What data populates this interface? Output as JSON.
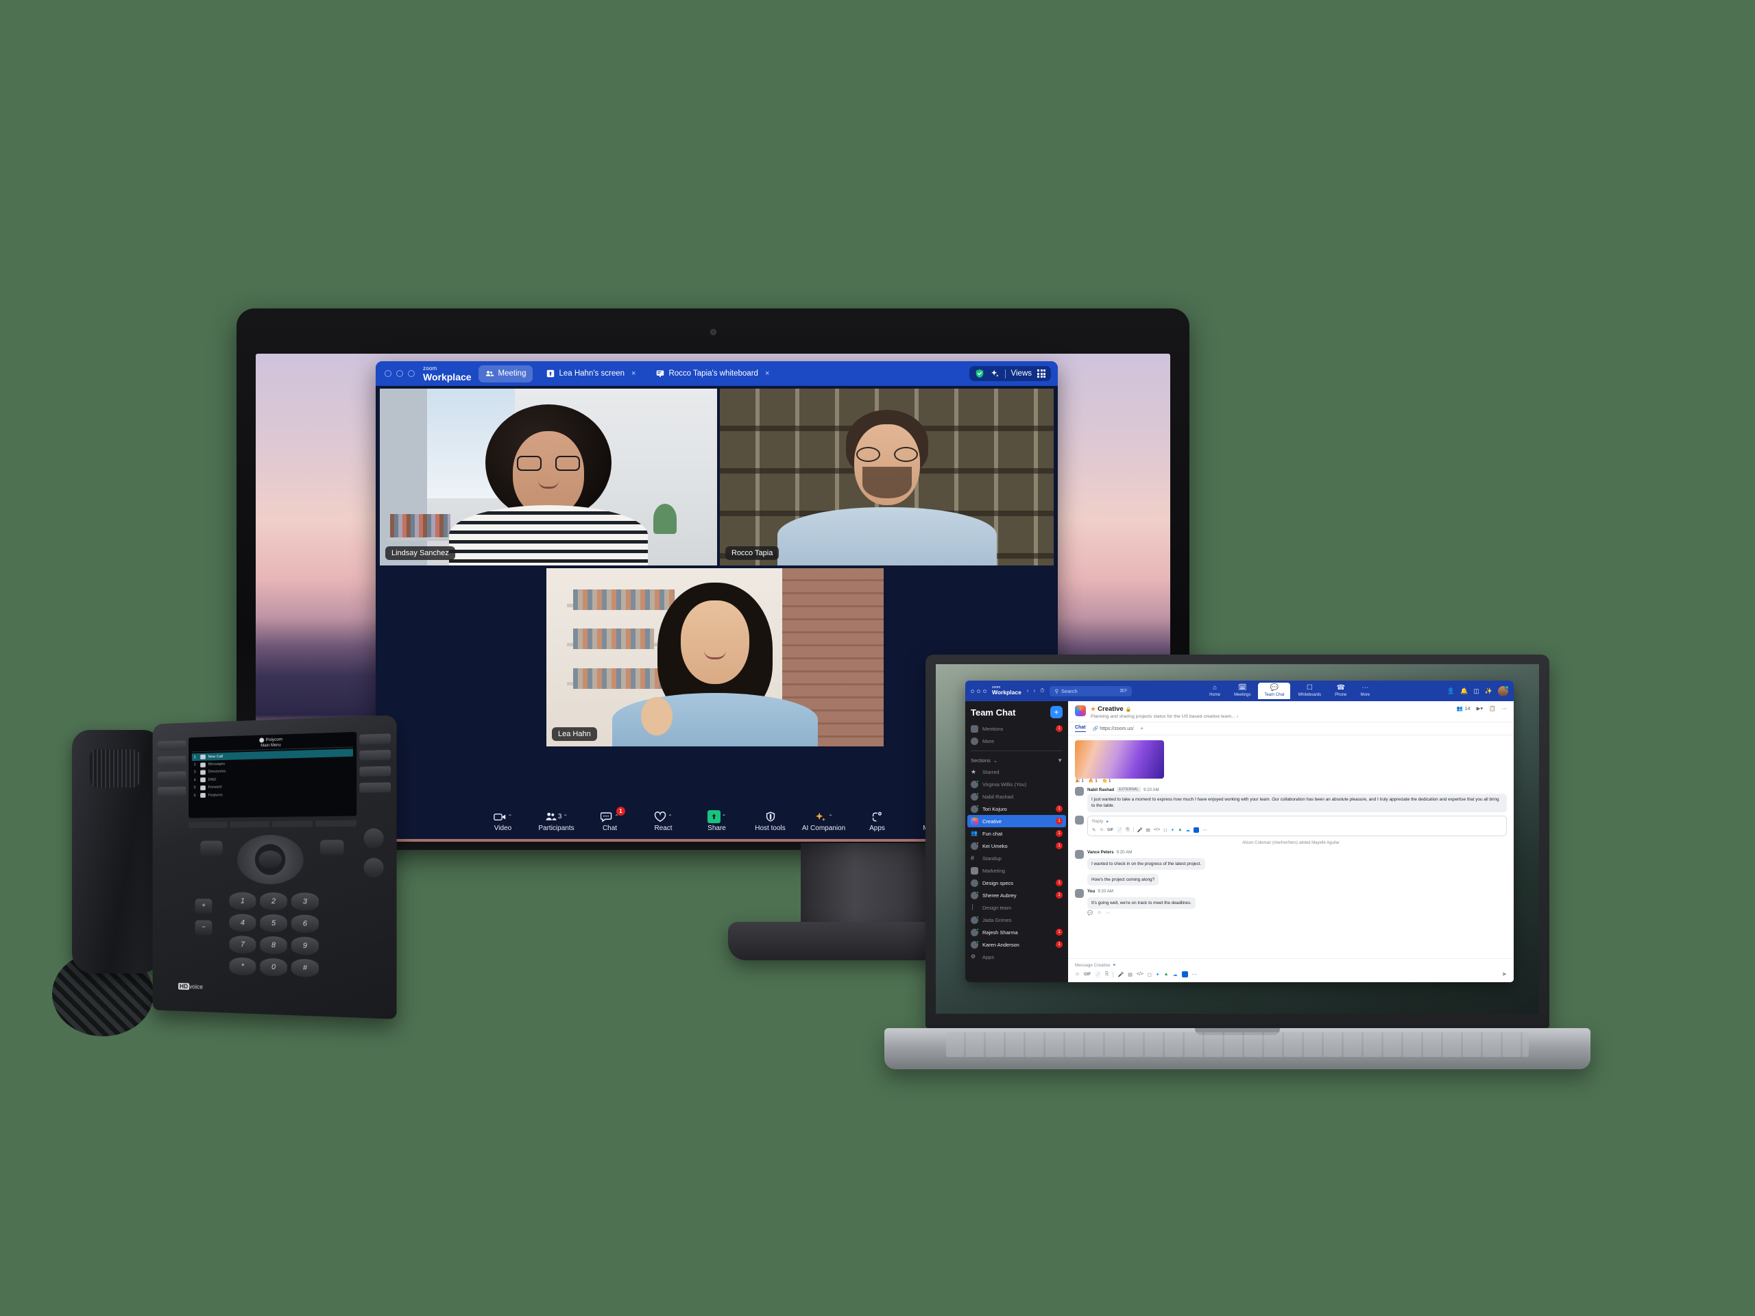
{
  "scene": {
    "background_color": "#4e7152",
    "devices": [
      "desktop-monitor",
      "laptop",
      "desk-phone"
    ]
  },
  "meeting_window": {
    "brand_line1": "zoom",
    "brand_line2": "Workplace",
    "tabs": [
      {
        "label": "Meeting",
        "icon": "participants-icon",
        "active": true,
        "closable": false
      },
      {
        "label": "Lea Hahn's screen",
        "icon": "share-screen-icon",
        "active": false,
        "closable": true,
        "close": "×"
      },
      {
        "label": "Rocco Tapia's whiteboard",
        "icon": "whiteboard-icon",
        "active": false,
        "closable": true,
        "close": "×"
      }
    ],
    "right_controls": {
      "encryption_icon": "shield-check-icon",
      "ai_icon": "ai-companion-sparkle-icon",
      "views_label": "Views",
      "views_icon": "grid-icon"
    },
    "participants": [
      {
        "name": "Lindsay Sanchez",
        "position": "top-left"
      },
      {
        "name": "Rocco Tapia",
        "position": "top-right"
      },
      {
        "name": "Lea Hahn",
        "position": "bottom-center"
      }
    ],
    "toolbar": [
      {
        "label": "Video",
        "icon": "video-camera-icon",
        "caret": "⌃",
        "badge": ""
      },
      {
        "label": "Participants",
        "icon": "participants-icon",
        "count": "3",
        "caret": "⌃",
        "badge": ""
      },
      {
        "label": "Chat",
        "icon": "chat-bubble-icon",
        "caret": "⌃",
        "badge": "1"
      },
      {
        "label": "React",
        "icon": "heart-icon",
        "caret": "⌃",
        "badge": ""
      },
      {
        "label": "Share",
        "icon": "share-arrow-icon",
        "caret": "⌃",
        "badge": ""
      },
      {
        "label": "Host tools",
        "icon": "shield-icon",
        "caret": "",
        "badge": ""
      },
      {
        "label": "AI Companion",
        "icon": "sparkle-icon",
        "caret": "⌃",
        "badge": ""
      },
      {
        "label": "Apps",
        "icon": "apps-icon",
        "caret": "",
        "badge": ""
      },
      {
        "label": "More",
        "icon": "more-dots-icon",
        "caret": "",
        "badge": "dot"
      }
    ]
  },
  "workplace": {
    "brand_line1": "zoom",
    "brand_line2": "Workplace",
    "nav_back": "‹",
    "nav_forward": "›",
    "history_icon": "clock-icon",
    "search": {
      "placeholder": "Search",
      "icon": "search-icon",
      "shortcut": "⌘F"
    },
    "main_menu": [
      {
        "label": "Home",
        "icon": "home-icon",
        "active": false
      },
      {
        "label": "Meetings",
        "icon": "calendar-icon",
        "active": false
      },
      {
        "label": "Team Chat",
        "icon": "team-chat-icon",
        "active": true
      },
      {
        "label": "Whiteboards",
        "icon": "whiteboard-icon",
        "active": false
      },
      {
        "label": "Phone",
        "icon": "phone-icon",
        "active": false
      },
      {
        "label": "More",
        "icon": "more-dots-icon",
        "active": false
      }
    ],
    "top_right_icons": [
      "contacts-icon",
      "bell-icon",
      "panel-icon",
      "sparkle-icon",
      "avatar"
    ],
    "sidebar": {
      "title": "Team Chat",
      "add_button": "+",
      "top_items": [
        {
          "label": "Mentions",
          "icon": "at-icon",
          "count": "1",
          "avatar": false
        },
        {
          "label": "More",
          "icon": "avatar-icon",
          "count": "",
          "avatar": true
        }
      ],
      "sections_label": "Sections",
      "sections_caret": "⌄",
      "filter_icon": "filter-icon",
      "items": [
        {
          "label": "Starred",
          "icon": "star-icon",
          "count": "",
          "type": "group",
          "presence": ""
        },
        {
          "label": "Virginia Willis (You)",
          "icon": "avatar",
          "count": "",
          "type": "dm",
          "presence": "available"
        },
        {
          "label": "Nabil Rashad",
          "icon": "avatar",
          "count": "",
          "type": "dm",
          "presence": "available"
        },
        {
          "label": "Tori Kojuro",
          "icon": "avatar",
          "count": "1",
          "type": "dm",
          "presence": "available"
        },
        {
          "label": "Creative",
          "icon": "channel-avatar",
          "count": "1",
          "type": "channel",
          "selected": true,
          "presence": ""
        },
        {
          "label": "Fun chat",
          "icon": "group-icon",
          "count": "1",
          "type": "channel",
          "presence": ""
        },
        {
          "label": "Kei Umeko",
          "icon": "avatar",
          "count": "1",
          "type": "dm",
          "presence": "away"
        },
        {
          "label": "Standup",
          "icon": "hash-icon",
          "count": "",
          "type": "channel",
          "presence": ""
        },
        {
          "label": "Marketing",
          "icon": "folder-icon",
          "count": "",
          "type": "folder",
          "presence": ""
        },
        {
          "label": "Design specs",
          "icon": "avatar",
          "count": "1",
          "type": "channel",
          "presence": ""
        },
        {
          "label": "Sheree Aubrey",
          "icon": "avatar",
          "count": "1",
          "type": "dm",
          "presence": "available"
        },
        {
          "label": "Design team",
          "icon": "tree-icon",
          "count": "",
          "type": "folder",
          "presence": ""
        },
        {
          "label": "Jada Grimes",
          "icon": "avatar",
          "count": "",
          "type": "dm",
          "presence": "available"
        },
        {
          "label": "Rajesh Sharma",
          "icon": "avatar",
          "count": "1",
          "type": "dm",
          "presence": "available"
        },
        {
          "label": "Karen Anderson",
          "icon": "avatar",
          "count": "1",
          "type": "dm",
          "presence": "available"
        },
        {
          "label": "Apps",
          "icon": "apps-icon",
          "count": "",
          "type": "group",
          "presence": ""
        }
      ]
    },
    "channel": {
      "star_icon": "star-icon",
      "name": "Creative",
      "lock_icon": "lock-icon",
      "description": "Planning and sharing projects status for the US based creative team...",
      "description_more": "›",
      "member_icon": "members-icon",
      "member_count": "14",
      "meet_icon": "video-camera-icon",
      "meet_caret": "⌄",
      "files_icon": "clipboard-icon",
      "more_icon": "more-dots-icon",
      "tabs": [
        {
          "label": "Chat",
          "active": true
        },
        {
          "label": "https://zoom.us/",
          "icon": "link-icon",
          "active": false
        },
        {
          "label": "+",
          "active": false
        }
      ]
    },
    "messages": [
      {
        "type": "image",
        "reactions": [
          {
            "emoji": "🎉",
            "count": "1"
          },
          {
            "emoji": "🔥",
            "count": "1"
          },
          {
            "emoji": "👏",
            "count": "1"
          }
        ]
      },
      {
        "type": "text",
        "author": "Nabil Rashad",
        "tag": "EXTERNAL",
        "time": "9:20 AM",
        "text": "I just wanted to take a moment to express how much I have enjoyed working with your team. Our collaboration has been an absolute pleasure, and I truly appreciate the dedication and expertise that you all bring to the table."
      },
      {
        "type": "reply",
        "placeholder": "Reply",
        "sparkle": "✦"
      },
      {
        "type": "system",
        "text": "Alison Coleman (she/her/hers) added Mayelle Aguilar"
      },
      {
        "type": "text",
        "author": "Vance Peters",
        "tag": "",
        "time": "9:20 AM",
        "text": "I wanted to check in on the progress of the latest project."
      },
      {
        "type": "text-cont",
        "text": "How's the project coming along?"
      },
      {
        "type": "text",
        "author": "You",
        "tag": "",
        "time": "9:20 AM",
        "text": "It's going well, we're on track to meet the deadlines."
      }
    ],
    "message_actions": [
      "reply-icon",
      "emoji-icon",
      "more-dots-icon"
    ],
    "composer": {
      "placeholder": "Message Creative",
      "sparkle": "✦",
      "tools": [
        "emoji-icon",
        "gif-icon",
        "file-icon",
        "screenshot-icon",
        "audio-icon",
        "video-message-icon",
        "code-icon",
        "share-screen-icon",
        "zoom-apps-icon",
        "google-drive-icon",
        "dropbox-icon",
        "box-icon",
        "more-dots-icon"
      ],
      "send_icon": "send-icon"
    },
    "reply_tools": [
      "format-icon",
      "emoji-icon",
      "gif-icon",
      "file-icon",
      "screenshot-icon",
      "audio-icon",
      "video-message-icon",
      "code-icon",
      "share-screen-icon",
      "zoom-apps-icon",
      "google-drive-icon",
      "dropbox-icon",
      "box-icon",
      "more-dots-icon"
    ]
  },
  "desk_phone": {
    "brand": "Polycom",
    "brand_mark": "◈",
    "screen_title": "Main Menu",
    "menu_items": [
      {
        "num": "1",
        "label": "New Call",
        "icon": "handset-icon",
        "selected": true
      },
      {
        "num": "2",
        "label": "Messages",
        "icon": "voicemail-icon",
        "selected": false
      },
      {
        "num": "3",
        "label": "Directories",
        "icon": "contacts-icon",
        "selected": false
      },
      {
        "num": "4",
        "label": "DND",
        "icon": "dnd-icon",
        "selected": false
      },
      {
        "num": "5",
        "label": "Forward",
        "icon": "forward-icon",
        "selected": false
      },
      {
        "num": "6",
        "label": "Features",
        "icon": "features-icon",
        "selected": false
      }
    ],
    "keypad": [
      "1",
      "2",
      "3",
      "4",
      "5",
      "6",
      "7",
      "8",
      "9",
      "*",
      "0",
      "#"
    ],
    "volume_up": "+",
    "volume_down": "−",
    "hd_label_bold": "HD",
    "hd_label_rest": "voice",
    "nav_prev_icon": "prev-icon",
    "nav_home_icon": "home-icon"
  },
  "colors": {
    "zoom_blue": "#1c49c4",
    "workplace_blue": "#1c3fa8",
    "accent_blue": "#2d8cff",
    "badge_red": "#e02020",
    "presence_green": "#19c37d",
    "presence_orange": "#f0913a",
    "scene_green": "#4e7152"
  }
}
